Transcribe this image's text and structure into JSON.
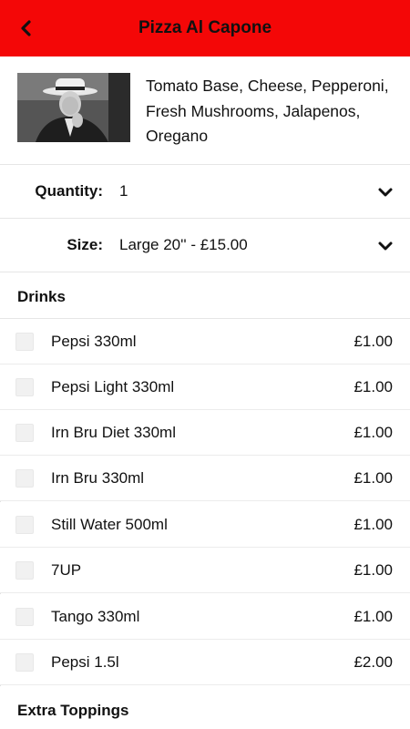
{
  "header": {
    "title": "Pizza Al Capone",
    "back_icon": "chevron-left-icon",
    "color": "#f40707"
  },
  "item": {
    "description": "Tomato Base, Cheese, Pepperoni, Fresh Mushrooms, Jalapenos, Oregano"
  },
  "options": {
    "quantity_label": "Quantity:",
    "quantity_value": "1",
    "size_label": "Size:",
    "size_value": "Large 20'' - £15.00"
  },
  "drinks": {
    "title": "Drinks",
    "items": [
      {
        "name": "Pepsi 330ml",
        "price": "£1.00"
      },
      {
        "name": "Pepsi Light 330ml",
        "price": "£1.00"
      },
      {
        "name": "Irn Bru Diet 330ml",
        "price": "£1.00"
      },
      {
        "name": "Irn Bru 330ml",
        "price": "£1.00"
      },
      {
        "name": "Still Water 500ml",
        "price": "£1.00"
      },
      {
        "name": "7UP",
        "price": "£1.00"
      },
      {
        "name": "Tango 330ml",
        "price": "£1.00"
      },
      {
        "name": "Pepsi 1.5l",
        "price": "£2.00"
      }
    ]
  },
  "extra_toppings": {
    "title": "Extra Toppings"
  }
}
